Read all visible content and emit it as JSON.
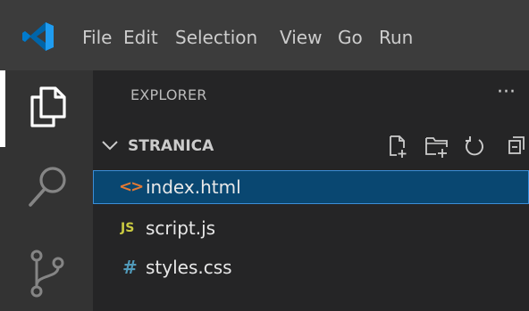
{
  "menubar": {
    "items": [
      "File",
      "Edit",
      "Selection",
      "View",
      "Go",
      "Run"
    ]
  },
  "activity_bar": {
    "icons": [
      "explorer-icon",
      "search-icon",
      "source-control-icon"
    ],
    "active": "explorer-icon"
  },
  "explorer": {
    "title": "EXPLORER",
    "more_label": "···",
    "folder": {
      "name": "STRANICA",
      "actions": [
        "new-file-icon",
        "new-folder-icon",
        "refresh-icon",
        "collapse-all-icon"
      ]
    },
    "files": [
      {
        "name": "index.html",
        "icon": "html-icon",
        "icon_text": "<>",
        "icon_color": "#e37933",
        "selected": true
      },
      {
        "name": "script.js",
        "icon": "js-icon",
        "icon_text": "JS",
        "icon_color": "#cbcb41",
        "selected": false
      },
      {
        "name": "styles.css",
        "icon": "css-icon",
        "icon_text": "#",
        "icon_color": "#519aba",
        "selected": false
      }
    ]
  },
  "colors": {
    "titlebar": "#3c3c3c",
    "activity_bar": "#333333",
    "sidebar": "#252526",
    "selection": "#094771",
    "accent_blue": "#007acc"
  }
}
